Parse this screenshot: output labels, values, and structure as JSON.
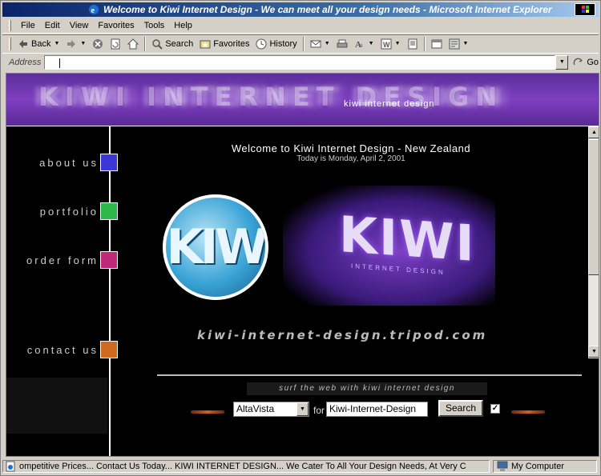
{
  "window": {
    "title": "Welcome to Kiwi Internet Design - We can meet all your design needs - Microsoft Internet Explorer"
  },
  "menu": [
    "File",
    "Edit",
    "View",
    "Favorites",
    "Tools",
    "Help"
  ],
  "toolbar": {
    "back_label": "Back",
    "search_label": "Search",
    "favorites_label": "Favorites",
    "history_label": "History"
  },
  "address": {
    "label": "Address",
    "value": "",
    "go_label": "Go"
  },
  "banner": {
    "logo_text": "KIWI INTERNET DESIGN",
    "tagline": "kiwi internet design"
  },
  "nav": {
    "items": [
      {
        "label": "about us",
        "color": "#3b36d6"
      },
      {
        "label": "portfolio",
        "color": "#2fb84a"
      },
      {
        "label": "order form",
        "color": "#c0287a"
      },
      {
        "label": "contact us",
        "color": "#d06a20"
      }
    ]
  },
  "content": {
    "welcome": "Welcome to Kiwi Internet Design - New Zealand",
    "date": "Today is Monday, April 2, 2001",
    "circle_logo_text": "KIW",
    "sign_text": "KIWI",
    "sign_subtext": "INTERNET DESIGN",
    "site_url": "kiwi-internet-design.tripod.com"
  },
  "search": {
    "heading": "surf the web with kiwi internet design",
    "engine": "AltaVista",
    "for_label": "for",
    "query": "Kiwi-Internet-Design",
    "button_label": "Search",
    "checkbox_checked": true
  },
  "status": {
    "text": "ompetitive Prices... Contact Us Today...   KIWI INTERNET DESIGN... We Cater To All Your Design Needs, At Very C",
    "zone": "My Computer"
  }
}
